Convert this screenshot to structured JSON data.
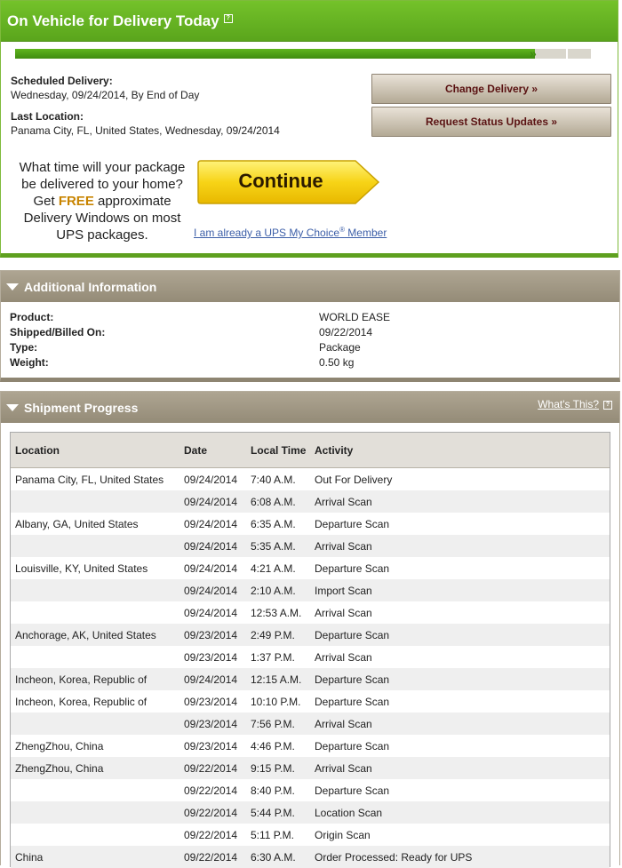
{
  "status": {
    "title": "On Vehicle for Delivery Today",
    "scheduled_label": "Scheduled Delivery:",
    "scheduled_value": "Wednesday, 09/24/2014, By End of Day",
    "last_location_label": "Last Location:",
    "last_location_value": "Panama City, FL, United States, Wednesday, 09/24/2014",
    "progress_fraction": 0.9,
    "change_delivery_label": "Change Delivery »",
    "request_updates_label": "Request Status Updates »"
  },
  "promo": {
    "line1": "What time will your package be delivered to your home? Get",
    "free": "FREE",
    "line2": "approximate Delivery Windows on most UPS packages.",
    "continue_label": "Continue",
    "member_link_text": "I am already a UPS My Choice",
    "member_link_mark": "®",
    "member_link_suffix": " Member"
  },
  "additional_info": {
    "title": "Additional Information",
    "rows": [
      {
        "label": "Product:",
        "value": "WORLD EASE"
      },
      {
        "label": "Shipped/Billed On:",
        "value": "09/22/2014"
      },
      {
        "label": "Type:",
        "value": "Package"
      },
      {
        "label": "Weight:",
        "value": "0.50 kg"
      }
    ]
  },
  "shipment_progress": {
    "title": "Shipment Progress",
    "whats_this": "What's This?",
    "columns": {
      "location": "Location",
      "date": "Date",
      "local_time": "Local Time",
      "activity": "Activity"
    },
    "rows": [
      {
        "location": "Panama City, FL, United States",
        "date": "09/24/2014",
        "time": "7:40 A.M.",
        "activity": "Out For Delivery"
      },
      {
        "location": "",
        "date": "09/24/2014",
        "time": "6:08 A.M.",
        "activity": "Arrival Scan"
      },
      {
        "location": "Albany, GA, United States",
        "date": "09/24/2014",
        "time": "6:35 A.M.",
        "activity": "Departure Scan"
      },
      {
        "location": "",
        "date": "09/24/2014",
        "time": "5:35 A.M.",
        "activity": "Arrival Scan"
      },
      {
        "location": "Louisville, KY, United States",
        "date": "09/24/2014",
        "time": "4:21 A.M.",
        "activity": "Departure Scan"
      },
      {
        "location": "",
        "date": "09/24/2014",
        "time": "2:10 A.M.",
        "activity": "Import Scan"
      },
      {
        "location": "",
        "date": "09/24/2014",
        "time": "12:53 A.M.",
        "activity": "Arrival Scan"
      },
      {
        "location": "Anchorage, AK, United States",
        "date": "09/23/2014",
        "time": "2:49 P.M.",
        "activity": "Departure Scan"
      },
      {
        "location": "",
        "date": "09/23/2014",
        "time": "1:37 P.M.",
        "activity": "Arrival Scan"
      },
      {
        "location": "Incheon, Korea, Republic of",
        "date": "09/24/2014",
        "time": "12:15 A.M.",
        "activity": "Departure Scan"
      },
      {
        "location": "Incheon, Korea, Republic of",
        "date": "09/23/2014",
        "time": "10:10 P.M.",
        "activity": "Departure Scan"
      },
      {
        "location": "",
        "date": "09/23/2014",
        "time": "7:56 P.M.",
        "activity": "Arrival Scan"
      },
      {
        "location": "ZhengZhou, China",
        "date": "09/23/2014",
        "time": "4:46 P.M.",
        "activity": "Departure Scan"
      },
      {
        "location": "ZhengZhou, China",
        "date": "09/22/2014",
        "time": "9:15 P.M.",
        "activity": "Arrival Scan"
      },
      {
        "location": "",
        "date": "09/22/2014",
        "time": "8:40 P.M.",
        "activity": "Departure Scan"
      },
      {
        "location": "",
        "date": "09/22/2014",
        "time": "5:44 P.M.",
        "activity": "Location Scan"
      },
      {
        "location": "",
        "date": "09/22/2014",
        "time": "5:11 P.M.",
        "activity": "Origin Scan"
      },
      {
        "location": "China",
        "date": "09/22/2014",
        "time": "6:30 A.M.",
        "activity": "Order Processed: Ready for UPS"
      }
    ]
  }
}
